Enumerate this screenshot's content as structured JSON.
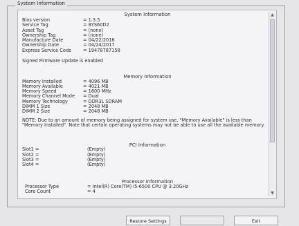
{
  "group_title": "System Information",
  "system": {
    "heading": "System Information",
    "rows": [
      {
        "label": "Bios version",
        "value": "= 1.3.5"
      },
      {
        "label": "Service Tag",
        "value": "= 8YS60D2"
      },
      {
        "label": "Asset Tag",
        "value": "= (none)"
      },
      {
        "label": "Ownership Tag",
        "value": "= (none)"
      },
      {
        "label": "Manufacture Date",
        "value": "= 04/22/2016"
      },
      {
        "label": "Ownership Date",
        "value": "= 04/24/2017"
      },
      {
        "label": "Express Service Code",
        "value": "= 19478787158"
      }
    ],
    "firmware_note": "Signed Firmware Update is enabled"
  },
  "memory": {
    "heading": "Memory Information",
    "rows": [
      {
        "label": "Memory Installed",
        "value": "= 4096 MB"
      },
      {
        "label": "Memory Available",
        "value": "= 4021 MB"
      },
      {
        "label": "Memory Speed",
        "value": "= 1600 MHz"
      },
      {
        "label": "Memory Channel Mode",
        "value": "= Dual"
      },
      {
        "label": "Memory Technology",
        "value": "= DDR3L SDRAM"
      },
      {
        "label": "DIMM 1 Size",
        "value": "= 2048 MB"
      },
      {
        "label": "DIMM 2 Size",
        "value": "= 2048 MB"
      }
    ],
    "note": "NOTE: Due to an amount of memory being assigned for system use, \"Memory Available\" is less than \"Memory Installed\". Note that certain operating systems may not be able to use all the available memory."
  },
  "pci": {
    "heading": "PCI Information",
    "rows": [
      {
        "label": "Slot1 =",
        "value": "(Empty)"
      },
      {
        "label": "Slot2 =",
        "value": "(Empty)"
      },
      {
        "label": "Slot3 =",
        "value": "(Empty)"
      },
      {
        "label": "Slot4 =",
        "value": "(Empty)"
      }
    ]
  },
  "processor": {
    "heading": "Processor Information",
    "rows": [
      {
        "label": "Processor Type",
        "value": "= Intel(R) Core(TM) i5-6500 CPU @ 3.20GHz"
      },
      {
        "label": "Core Count",
        "value": "= 4"
      }
    ]
  },
  "buttons": {
    "restore": "Restore Settings",
    "middle": "",
    "exit": "Exit"
  },
  "scroll": {
    "up_glyph": "▲",
    "down_glyph": "▼"
  }
}
